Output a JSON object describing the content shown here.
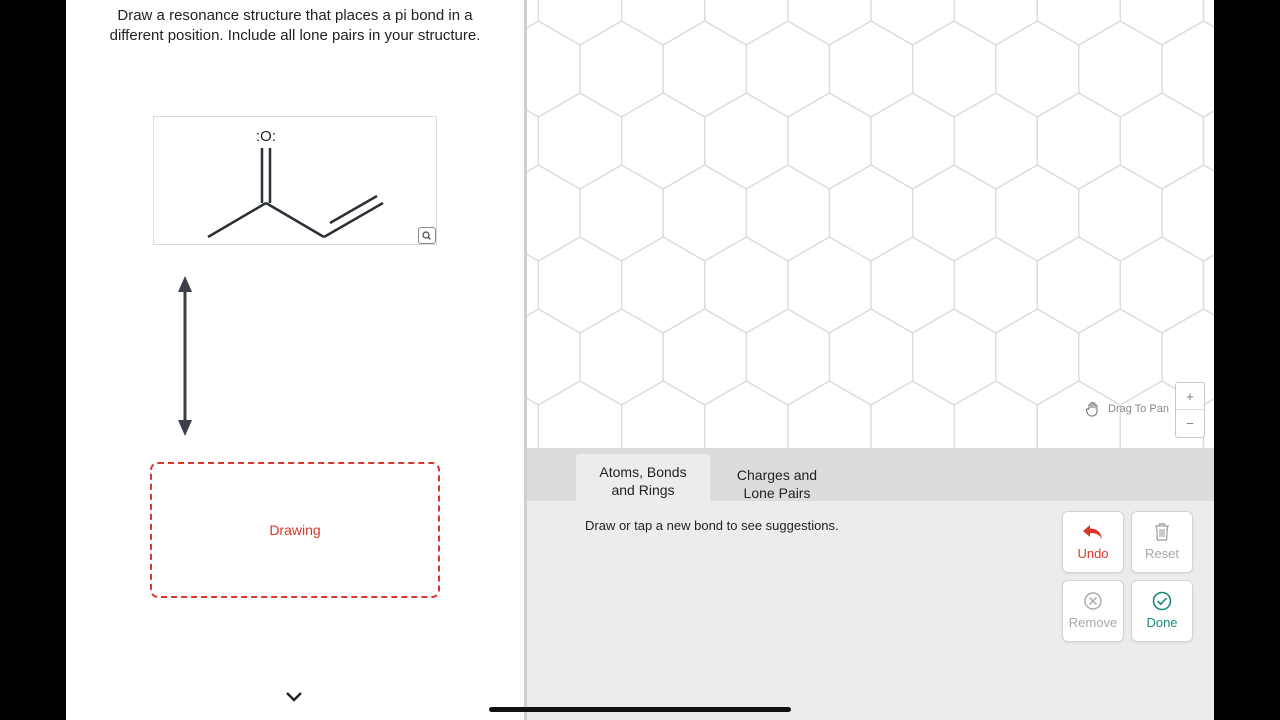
{
  "question": {
    "line1": "Draw a resonance structure that places a pi bond in a",
    "line2": "different position. Include all lone pairs in your structure."
  },
  "structure": {
    "oxygen_label": ":O:"
  },
  "drawing_area": {
    "label": "Drawing"
  },
  "canvas": {
    "drag_hint": "Drag To Pan",
    "zoom_in_label": "+",
    "zoom_out_label": "−"
  },
  "tabs": [
    {
      "line1": "Atoms, Bonds",
      "line2": "and Rings",
      "active": true
    },
    {
      "line1": "Charges and",
      "line2": "Lone Pairs",
      "active": false
    }
  ],
  "hint": "Draw or tap a new bond to see suggestions.",
  "toolbar": {
    "undo_label": "Undo",
    "reset_label": "Reset",
    "remove_label": "Remove",
    "done_label": "Done"
  },
  "colors": {
    "accent_red": "#d9372b",
    "done_teal": "#1a8a7a",
    "disabled_gray": "#a8a8a8"
  }
}
